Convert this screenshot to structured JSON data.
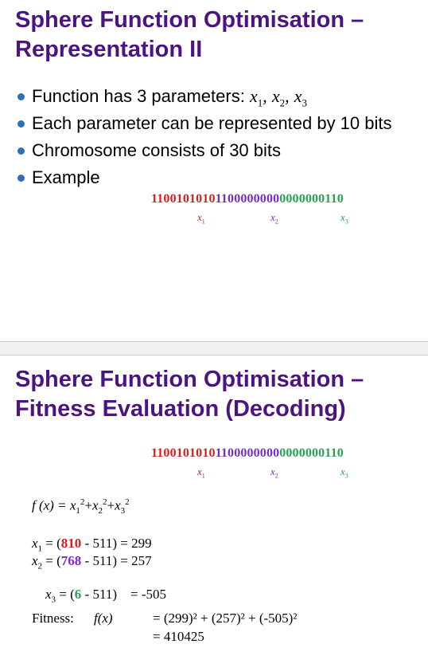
{
  "slide1": {
    "title_line1": "Sphere Function Optimisation –",
    "title_line2": "Representation II",
    "bullets": [
      {
        "text": "Function has 3 parameters:"
      },
      {
        "text": "Each parameter can be represented by 10 bits"
      },
      {
        "text": "Chromosome consists of 30 bits"
      },
      {
        "text": "Example"
      }
    ],
    "params": {
      "x": "x",
      "s1": "1",
      "s2": "2",
      "s3": "3",
      "sep": ","
    },
    "chromosome": {
      "part1": "1100101010",
      "part2": "1100000000",
      "part3": "0000000110"
    },
    "labels": {
      "x": "x",
      "s1": "1",
      "s2": "2",
      "s3": "3"
    }
  },
  "slide2": {
    "title_line1": "Sphere Function Optimisation –",
    "title_line2": "Fitness Evaluation (Decoding)",
    "chromosome": {
      "part1": "1100101010",
      "part2": "1100000000",
      "part3": "0000000110"
    },
    "labels": {
      "x": "x",
      "s1": "1",
      "s2": "2",
      "s3": "3"
    },
    "function": {
      "lhs": "f (x) = ",
      "x": "x",
      "s1": "1",
      "s2": "2",
      "s3": "3",
      "sq": "2",
      "plus": "+"
    },
    "decode": [
      {
        "var": "x",
        "sub": "1",
        "eq": " = (",
        "val": "810",
        "rest": " - 511) = 299"
      },
      {
        "var": "x",
        "sub": "2",
        "eq": " = (",
        "val": "768",
        "rest": " - 511) = 257"
      },
      {
        "var": "x",
        "sub": "3",
        "eq": " = (",
        "val": "6",
        "rest": " - 511)    = -505"
      }
    ],
    "fitness": {
      "label": "Fitness:",
      "fx": "f(x)",
      "eq1": "= (299)² + (257)² + (-505)²",
      "eq2": "= 410425"
    }
  },
  "colors": {
    "title": "#4b1482",
    "bullet": "#2f6fb5",
    "part1": "#d42020",
    "part2": "#7a2bc8",
    "part3": "#2aa058"
  }
}
